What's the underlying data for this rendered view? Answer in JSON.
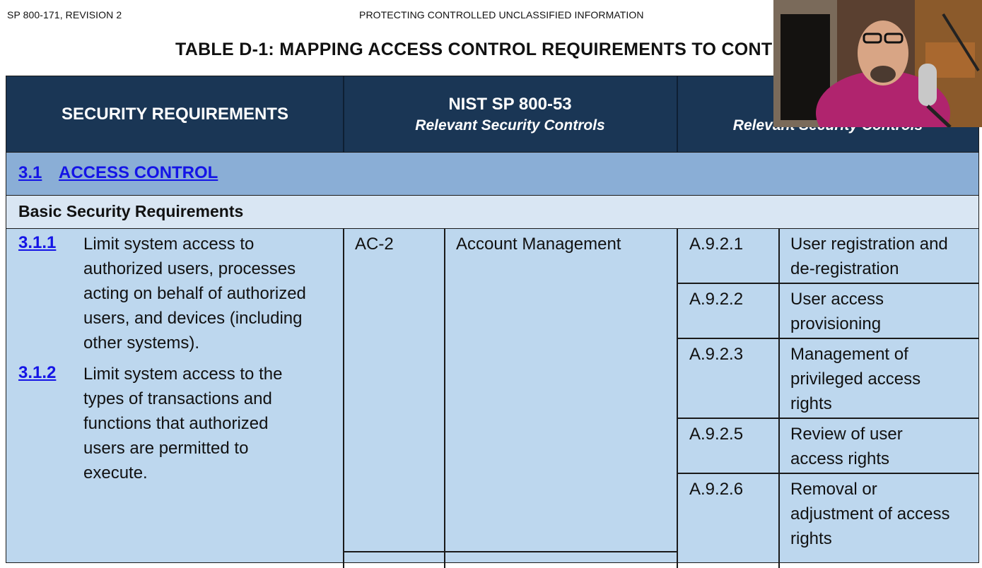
{
  "page_header": {
    "left": "SP 800-171, REVISION 2",
    "center": "PROTECTING CONTROLLED UNCLASSIFIED INFORMATION"
  },
  "table_title": "TABLE D-1:  MAPPING ACCESS CONTROL REQUIREMENTS TO CONTR",
  "columns": {
    "security_requirements": "SECURITY REQUIREMENTS",
    "nist_title": "NIST SP 800-53",
    "nist_sub": "Relevant Security Controls",
    "iso_title": "I",
    "iso_sub": "Relevant Security Controls"
  },
  "section": {
    "number": "3.1",
    "name": "ACCESS CONTROL"
  },
  "subsection_label": "Basic Security Requirements",
  "requirements": [
    {
      "id": "3.1.1",
      "lines": [
        "Limit system access to",
        "authorized users, processes",
        "acting on behalf of authorized",
        "users, and devices (including",
        "other systems)."
      ]
    },
    {
      "id": "3.1.2",
      "lines": [
        "Limit system access to the",
        "types of transactions and",
        "functions that authorized",
        "users are permitted to",
        "execute."
      ]
    }
  ],
  "nist_control": {
    "code": "AC-2",
    "name": "Account Management"
  },
  "iso_controls": [
    {
      "code": "A.9.2.1",
      "lines": [
        "User registration and",
        "de-registration"
      ]
    },
    {
      "code": "A.9.2.2",
      "lines": [
        "User access",
        "provisioning"
      ]
    },
    {
      "code": "A.9.2.3",
      "lines": [
        "Management of",
        "privileged access",
        "rights"
      ]
    },
    {
      "code": "A.9.2.5",
      "lines": [
        "Review of user",
        "access rights"
      ]
    },
    {
      "code": "A.9.2.6",
      "lines": [
        "Removal or",
        "adjustment of access",
        "rights"
      ]
    }
  ]
}
